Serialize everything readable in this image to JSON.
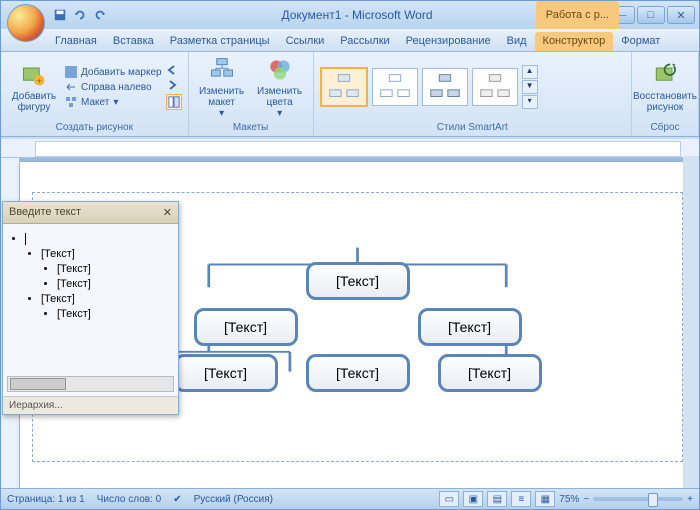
{
  "title": "Документ1 - Microsoft Word",
  "contextTab": "Работа с р...",
  "tabs": [
    "Главная",
    "Вставка",
    "Разметка страницы",
    "Ссылки",
    "Рассылки",
    "Рецензирование",
    "Вид",
    "Конструктор",
    "Формат"
  ],
  "activeTab": "Конструктор",
  "ribbon": {
    "group1": {
      "label": "Создать рисунок",
      "addShape": "Добавить\nфигуру",
      "bullet": "Добавить маркер",
      "rtl": "Справа налево",
      "layout": "Макет"
    },
    "group2": {
      "label": "Макеты",
      "changeLayout": "Изменить\nмакет",
      "changeColors": "Изменить\nцвета"
    },
    "group3": {
      "label": "Стили SmartArt"
    },
    "group4": {
      "label": "Сброс",
      "reset": "Восстановить\nрисунок"
    }
  },
  "textPane": {
    "title": "Введите текст",
    "items": [
      "",
      "[Текст]",
      "[Текст]",
      "[Текст]",
      "[Текст]",
      "[Текст]"
    ],
    "footer": "Иерархия..."
  },
  "nodeText": "[Текст]",
  "status": {
    "page": "Страница: 1 из 1",
    "words": "Число слов: 0",
    "lang": "Русский (Россия)",
    "zoom": "75%"
  }
}
